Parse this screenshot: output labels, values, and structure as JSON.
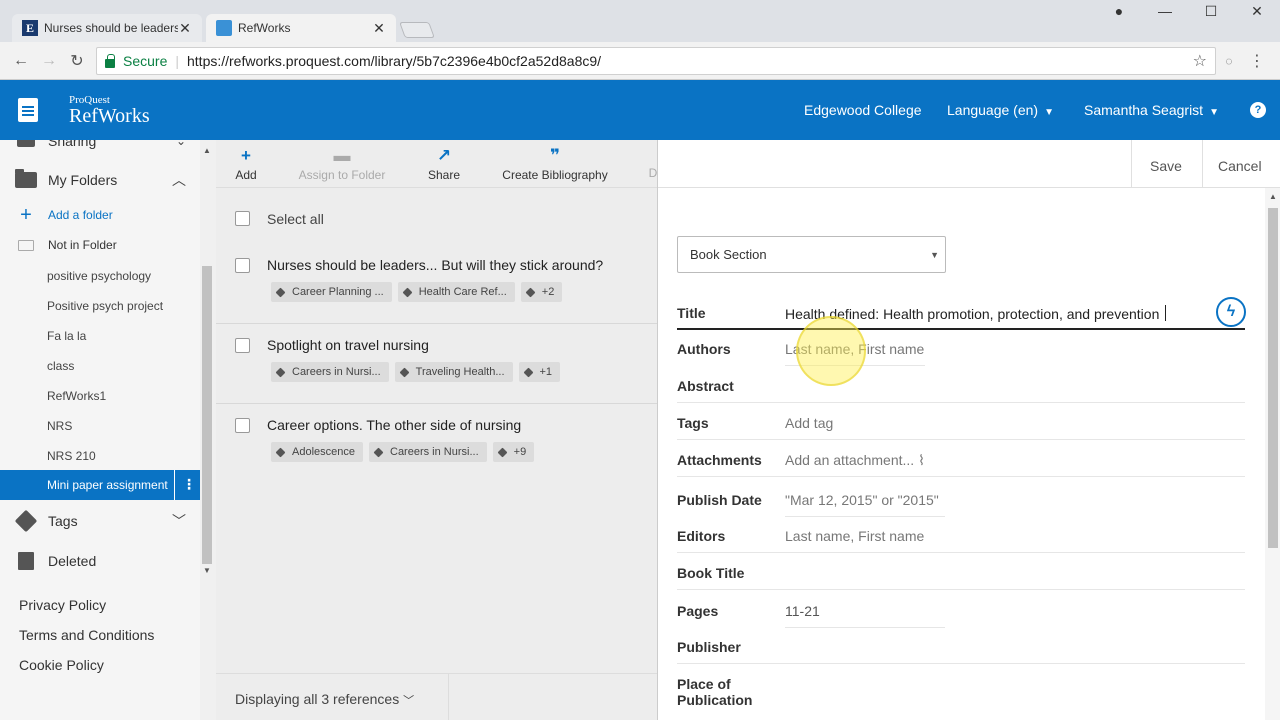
{
  "browser": {
    "tabs": [
      {
        "title": "Nurses should be leaders",
        "favicon": "E"
      },
      {
        "title": "RefWorks"
      }
    ],
    "secure_label": "Secure",
    "url": "https://refworks.proquest.com/library/5b7c2396e4b0cf2a52d8a8c9/"
  },
  "header": {
    "brand_top": "ProQuest",
    "brand_name": "RefWorks",
    "institution": "Edgewood College",
    "language": "Language (en)",
    "user": "Samantha Seagrist",
    "help": "?"
  },
  "sidebar": {
    "sharing": "Sharing",
    "my_folders": "My Folders",
    "add_folder": "Add a folder",
    "not_in_folder": "Not in Folder",
    "folders": [
      "positive psychology",
      "Positive psych project",
      "Fa la la",
      "class",
      "RefWorks1",
      "NRS",
      "NRS 210"
    ],
    "active_folder": "Mini paper assignment",
    "tags": "Tags",
    "deleted": "Deleted",
    "footer": [
      "Privacy Policy",
      "Terms and Conditions",
      "Cookie Policy"
    ]
  },
  "toolbar": {
    "add": "Add",
    "assign": "Assign to Folder",
    "share": "Share",
    "bibliography": "Create Bibliography",
    "more": "D"
  },
  "list": {
    "select_all": "Select all",
    "references": [
      {
        "title": "Nurses should be leaders... But will they stick around?",
        "tags": [
          "Career Planning ...",
          "Health Care Ref...",
          "+2"
        ]
      },
      {
        "title": "Spotlight on travel nursing",
        "tags": [
          "Careers in Nursi...",
          "Traveling Health...",
          "+1"
        ]
      },
      {
        "title": "Career options. The other side of nursing",
        "tags": [
          "Adolescence",
          "Careers in Nursi...",
          "+9"
        ]
      }
    ],
    "footer": "Displaying all 3 references"
  },
  "panel": {
    "save": "Save",
    "cancel": "Cancel",
    "ref_type": "Book Section",
    "fields": {
      "title_label": "Title",
      "title_value": "Health defined: Health promotion, protection, and prevention",
      "authors_label": "Authors",
      "authors_ph": "Last name, First name",
      "abstract_label": "Abstract",
      "tags_label": "Tags",
      "tags_ph": "Add tag",
      "attachments_label": "Attachments",
      "attachments_ph": "Add an attachment...",
      "publish_label": "Publish Date",
      "publish_ph": "\"Mar 12, 2015\" or \"2015\"",
      "editors_label": "Editors",
      "editors_ph": "Last name, First name",
      "booktitle_label": "Book Title",
      "pages_label": "Pages",
      "pages_value": "11-21",
      "publisher_label": "Publisher",
      "place_label_1": "Place of",
      "place_label_2": "Publication"
    }
  },
  "colors": {
    "brand_blue": "#0a73c4",
    "secure_green": "#0b8043"
  }
}
